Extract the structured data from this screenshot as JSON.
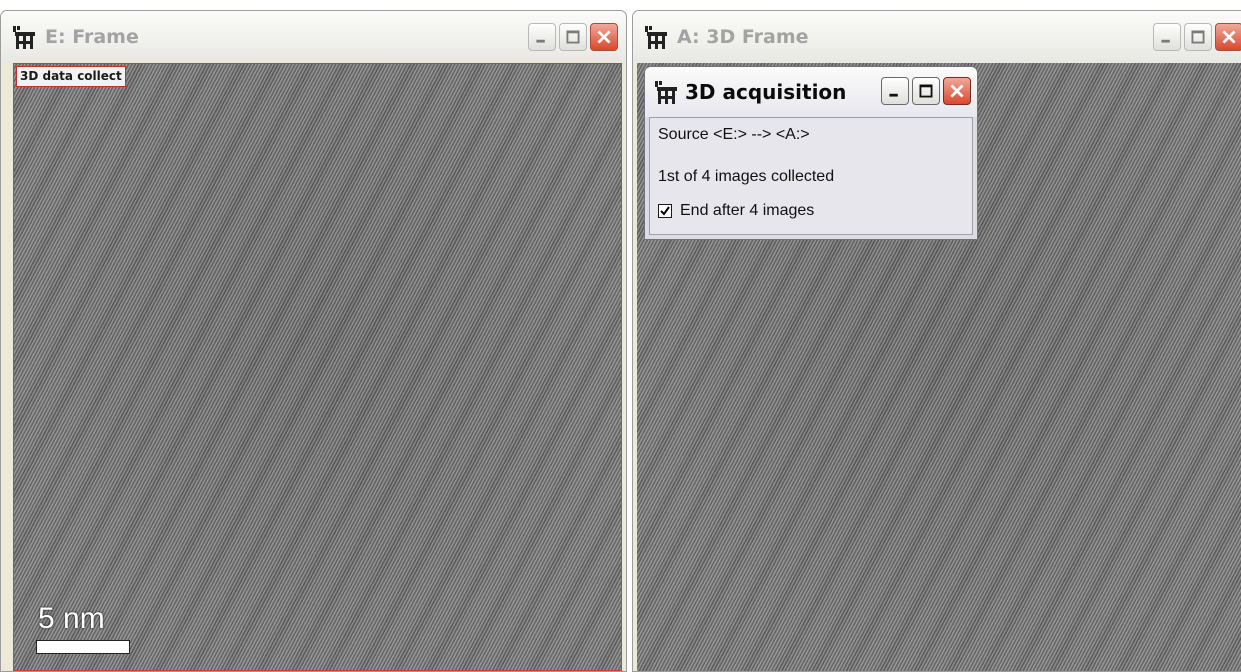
{
  "window_e": {
    "title": "E: Frame",
    "overlay_label": "3D data collect",
    "scale_bar_label": "5 nm"
  },
  "window_a": {
    "title": "A: 3D Frame"
  },
  "dialog": {
    "title": "3D acquisition",
    "source_text": "Source  <E:>  -->  <A:>",
    "status_text": "1st of 4 images collected",
    "checkbox_label": "End after 4 images",
    "checkbox_checked": true
  },
  "icons": {
    "app": "tripod-icon",
    "minimize": "minimize-icon",
    "maximize": "maximize-icon",
    "close": "close-icon"
  },
  "colors": {
    "close_button": "#d9482d",
    "selection_border": "#d33a3a",
    "title_inactive": "#a3a3a3"
  }
}
